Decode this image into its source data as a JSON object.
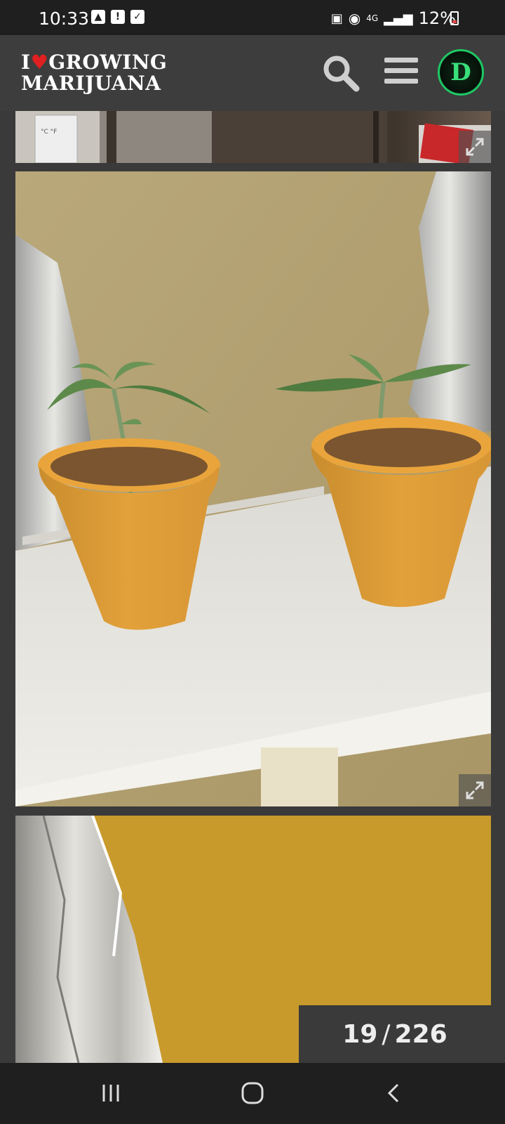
{
  "status_bar": {
    "time": "10:33",
    "network": "4G",
    "battery": "12%"
  },
  "header": {
    "logo_line1_a": "I",
    "logo_line1_b": "GROWING",
    "logo_line2": "MARIJUANA",
    "search_icon": "search-icon",
    "menu_icon": "menu-icon",
    "avatar_letter": "D"
  },
  "gallery": {
    "current": "19",
    "separator": "/",
    "total": "226"
  },
  "colors": {
    "accent_green": "#1ec764",
    "heart_red": "#e02020",
    "pot_orange": "#e3a13a"
  }
}
